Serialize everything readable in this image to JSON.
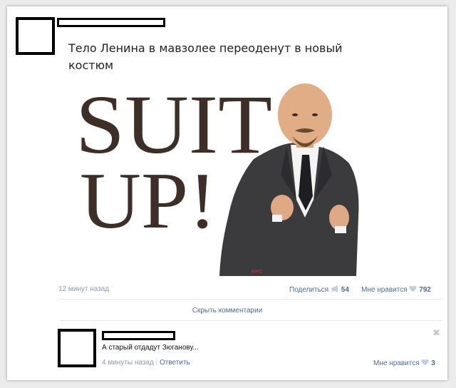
{
  "post": {
    "text": "Тело Ленина в мавзолее переоденут в новый костюм",
    "image": {
      "headline_line1": "SUIT",
      "headline_line2": "UP!",
      "watermark": "RPG"
    },
    "timestamp": "12 минут назад",
    "share_label": "Поделиться",
    "share_count": "54",
    "like_label": "Мне нравится",
    "like_count": "792",
    "hide_comments": "Скрыть комментарии"
  },
  "comment": {
    "text": "А старый отдадут Зюганову...",
    "timestamp": "4 минуты назад",
    "separator": "|",
    "reply_label": "Ответить",
    "like_label": "Мне нравится",
    "like_count": "3",
    "close_symbol": "✖"
  },
  "icons": {
    "share": "megaphone-icon",
    "like": "heart-icon",
    "close": "close-icon"
  },
  "colors": {
    "link": "#4d6e97",
    "meta": "#8a9bb2",
    "heart": "#c0cedd",
    "headline": "#3d2f27"
  }
}
